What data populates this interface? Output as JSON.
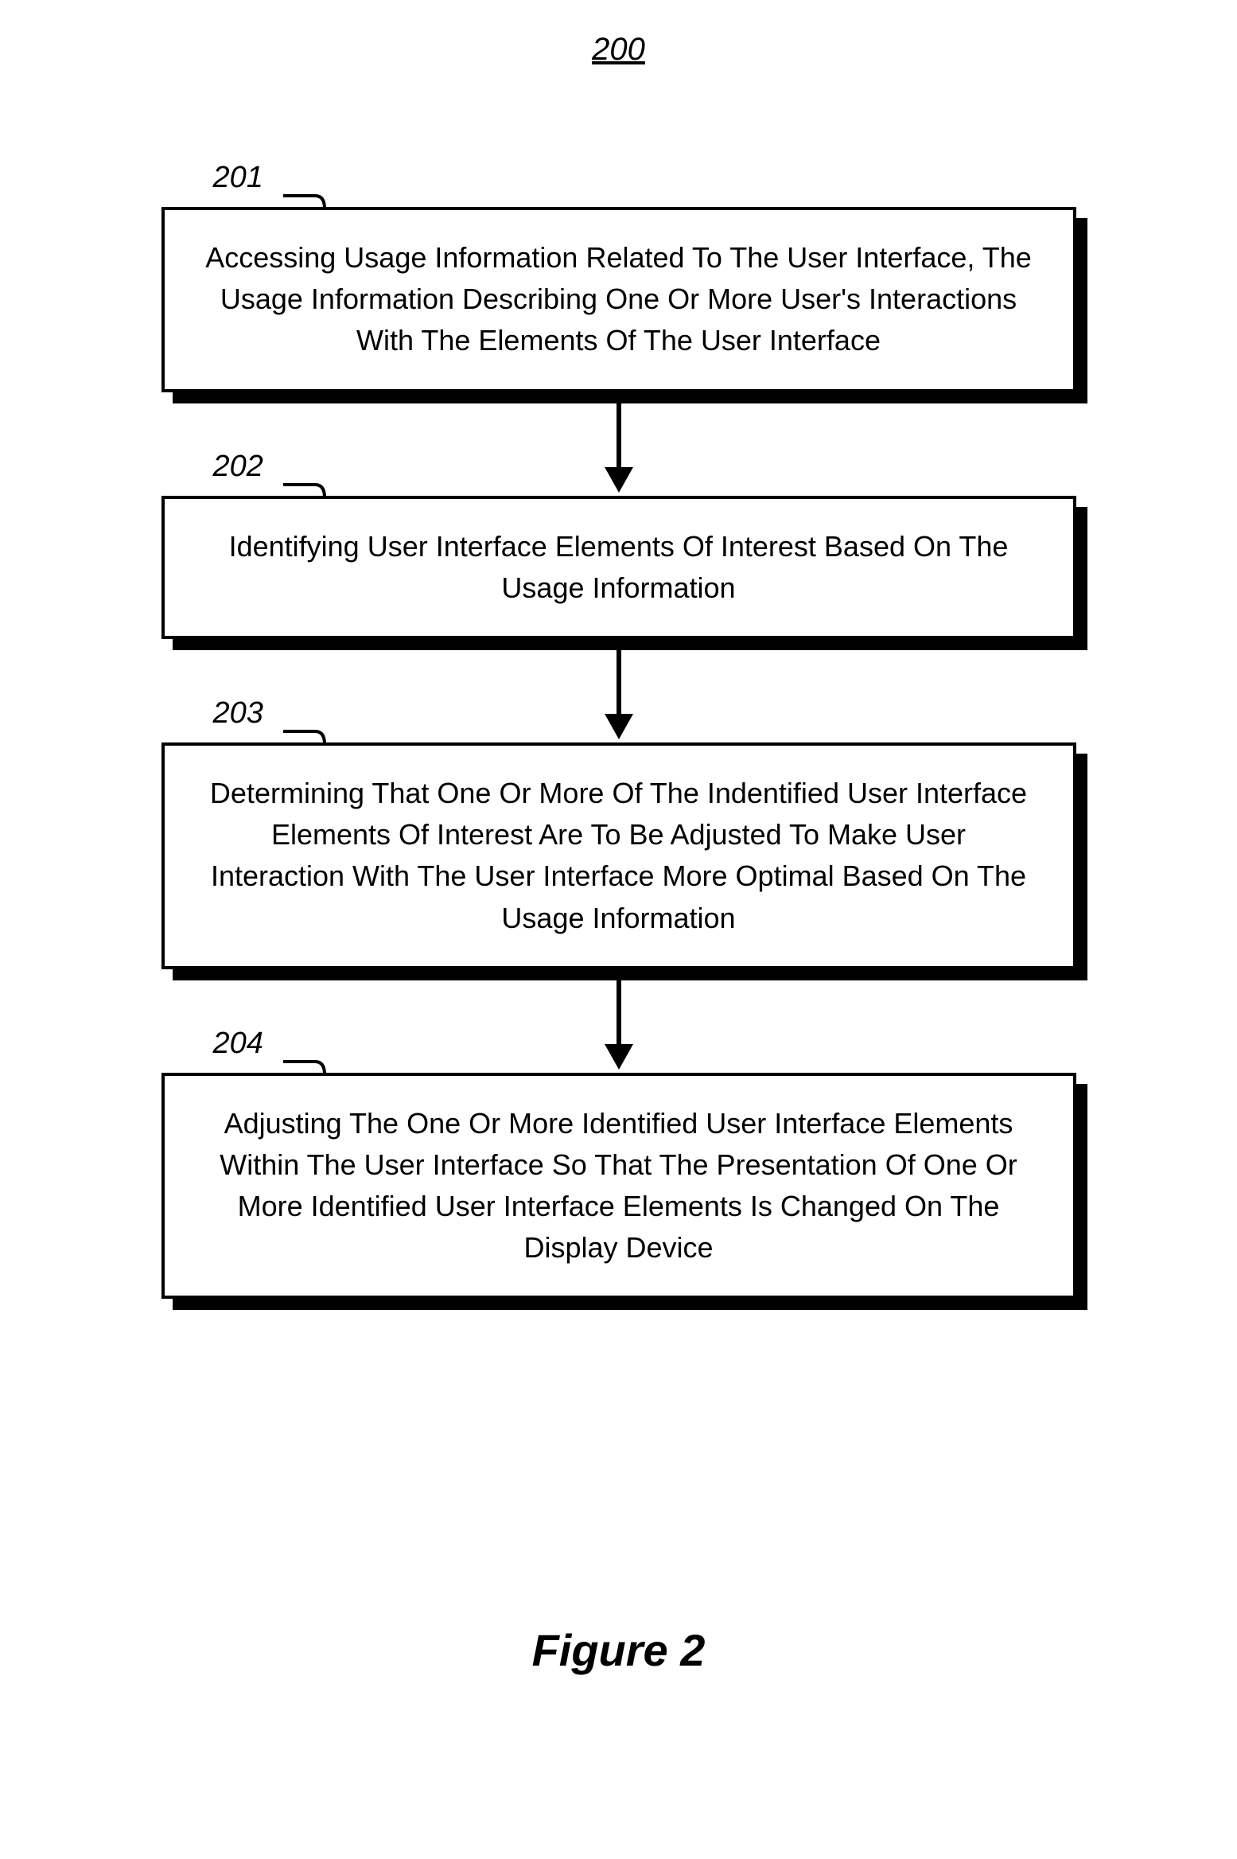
{
  "figure_number": "200",
  "caption": "Figure 2",
  "steps": [
    {
      "ref": "201",
      "text": "Accessing Usage Information Related To The User Interface, The Usage Information Describing One Or More User's Interactions With The Elements Of The User Interface"
    },
    {
      "ref": "202",
      "text": "Identifying User Interface Elements Of Interest Based On The Usage  Information"
    },
    {
      "ref": "203",
      "text": "Determining That One Or More Of The Indentified User Interface Elements Of Interest Are To Be Adjusted To Make User Interaction With The User Interface More Optimal Based On The Usage  Information"
    },
    {
      "ref": "204",
      "text": "Adjusting The One Or More Identified User Interface Elements Within The User Interface So That The Presentation Of One Or More Identified User Interface Elements Is Changed On The Display Device"
    }
  ]
}
